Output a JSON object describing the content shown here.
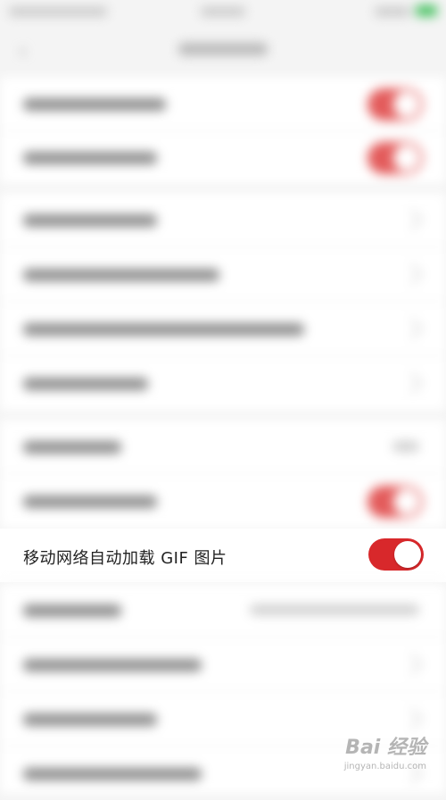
{
  "screen": {
    "row_label": "移动网络自动加载 GIF 图片",
    "toggle_state": "on"
  },
  "colors": {
    "accent": "#d8282b",
    "background": "#f4f4f4",
    "row_bg": "#ffffff"
  },
  "watermark": {
    "main": "Bai 经验",
    "sub": "jingyan.baidu.com"
  },
  "icons": {
    "back": "chevron-left-icon",
    "row_arrow": "chevron-right-icon",
    "paw": "paw-icon"
  }
}
